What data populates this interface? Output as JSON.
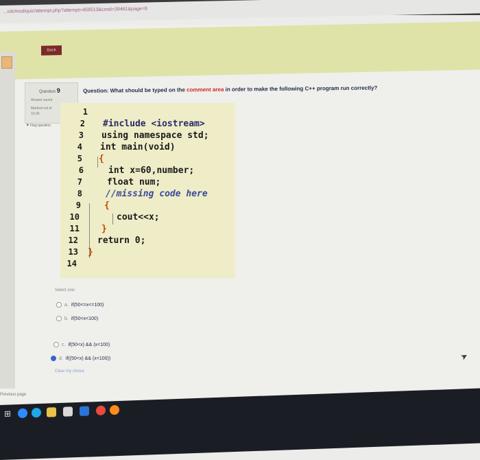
{
  "browser": {
    "url": "…ick/mod/quiz/attempt.php?attempt=459513&cmid=39461&page=8"
  },
  "nav": {
    "back_label": "Back"
  },
  "question_info": {
    "number_label": "Question",
    "number": "9",
    "status": "Answer saved",
    "marks": "Marked out of",
    "marks_value": "10.00",
    "flag_label": "Flag question"
  },
  "question": {
    "prefix": "Question: What should be typed on the ",
    "highlight": "comment area",
    "suffix": " in order to make the following C++ program run correctly?"
  },
  "code": {
    "line_numbers": [
      "1",
      "2",
      "3",
      "4",
      "5",
      "6",
      "7",
      "8",
      "9",
      "10",
      "11",
      "12",
      "13",
      "14"
    ],
    "lines": [
      "",
      "#include <iostream>",
      "using namespace std;",
      "int main(void)",
      "{",
      "int x=60,number;",
      "float num;",
      "//missing code here",
      "{",
      "cout<<x;",
      "}",
      "return 0;",
      "}",
      ""
    ]
  },
  "answers": {
    "select_label": "Select one:",
    "options": [
      {
        "letter": "a.",
        "text": "if(50<=x<=100)",
        "selected": false
      },
      {
        "letter": "b.",
        "text": "if(50<x<100)",
        "selected": false
      },
      {
        "letter": "c.",
        "text": "if(50<x) && (x<100)",
        "selected": false
      },
      {
        "letter": "d.",
        "text": "if((50<x) && (x<100))",
        "selected": true
      }
    ],
    "clear_label": "Clear my choice"
  },
  "footer": {
    "previous_page": "Previous page"
  },
  "colors": {
    "banner": "#dfe3a8",
    "code_bg": "#eeedc8",
    "highlight": "#cc2b2b",
    "selected_radio": "#3a63c9"
  },
  "taskbar": {
    "icons": [
      "windows-start-icon",
      "task-view-icon",
      "edge-icon",
      "file-explorer-icon",
      "store-icon",
      "mail-icon",
      "chrome-icon",
      "firefox-icon"
    ]
  }
}
